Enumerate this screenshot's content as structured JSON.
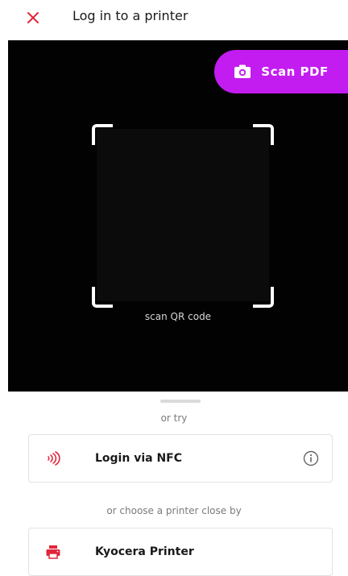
{
  "header": {
    "title": "Log in to a printer",
    "close_icon": "close-icon",
    "close_color": "#e0263a"
  },
  "camera": {
    "scan_pdf_label": "Scan PDF",
    "scan_pdf_icon": "camera-icon",
    "scan_pdf_color": "#c31cf0",
    "scan_label": "scan QR code"
  },
  "options": {
    "or_try": "or try",
    "nfc": {
      "label": "Login via NFC",
      "icon": "nfc-icon",
      "info_icon": "info-icon"
    },
    "or_choose": "or choose a printer close by",
    "printer": {
      "label": "Kyocera Printer",
      "icon": "printer-icon"
    }
  }
}
